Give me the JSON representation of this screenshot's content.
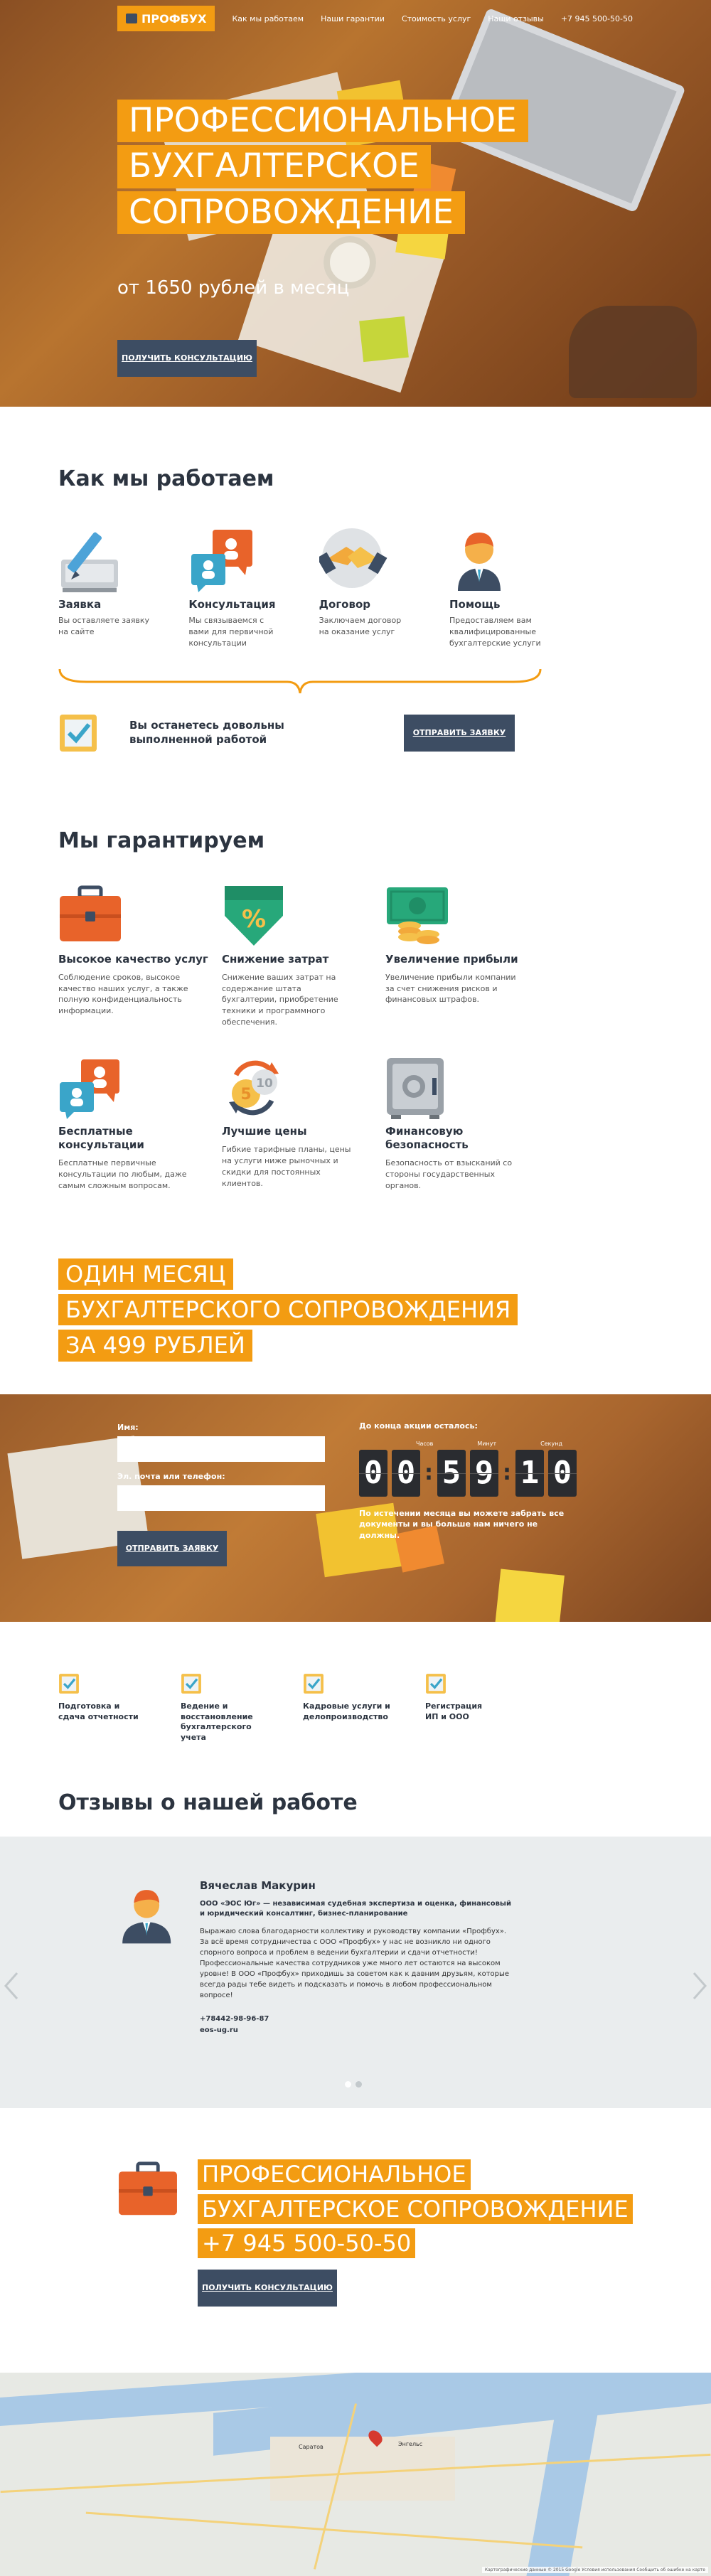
{
  "header": {
    "logo": "ПРОФБУХ",
    "nav": [
      "Как мы работаем",
      "Наши гарантии",
      "Стоимость услуг",
      "Наши отзывы",
      "+7 945 500-50-50"
    ]
  },
  "hero": {
    "title_lines": [
      "ПРОФЕССИОНАЛЬНОЕ",
      "БУХГАЛТЕРСКОЕ",
      "СОПРОВОЖДЕНИЕ"
    ],
    "subtitle": "от 1650 рублей в месяц",
    "button": "получить консультацию"
  },
  "how": {
    "title": "Как мы работаем",
    "steps": [
      {
        "title": "Заявка",
        "text": "Вы оставляете заявку на сайте",
        "icon": "pen-icon"
      },
      {
        "title": "Консультация",
        "text": "Мы связываемся с вами для первичной консультации",
        "icon": "chat-icon"
      },
      {
        "title": "Договор",
        "text": "Заключаем договор на оказание услуг",
        "icon": "handshake-icon"
      },
      {
        "title": "Помощь",
        "text": "Предоставляем вам квалифицированные бухгалтерские услуги",
        "icon": "person-icon"
      }
    ],
    "satisfied": "Вы останетесь довольны выполненной работой",
    "button": "отправить заявку"
  },
  "guarantees": {
    "title": "Мы гарантируем",
    "items": [
      {
        "title": "Высокое качество услуг",
        "text": "Соблюдение сроков, высокое качество наших услуг, а также полную конфиденциальность информации.",
        "icon": "briefcase-icon"
      },
      {
        "title": "Снижение затрат",
        "text": "Снижение ваших затрат на содержание штата бухгалтерии, приобретение техники и программного обеспечения.",
        "icon": "percent-icon"
      },
      {
        "title": "Увеличение прибыли",
        "text": "Увеличение прибыли компании за счет снижения рисков и финансовых штрафов.",
        "icon": "money-icon"
      },
      {
        "title": "Бесплатные консультации",
        "text": "Бесплатные первичные консультации по любым, даже самым сложным вопросам.",
        "icon": "chat-icon"
      },
      {
        "title": "Лучшие цены",
        "text": "Гибкие тарифные планы, цены на услуги ниже рыночных и скидки для постоянных клиентов.",
        "icon": "coins-icon"
      },
      {
        "title": "Финансовую безопасность",
        "text": "Безопасность от взысканий со стороны государственных органов.",
        "icon": "safe-icon"
      }
    ]
  },
  "promo": {
    "lines": [
      "ОДИН МЕСЯЦ",
      "БУХГАЛТЕРСКОГО СОПРОВОЖДЕНИЯ",
      "ЗА 499 РУБЛЕЙ"
    ]
  },
  "order": {
    "name_label": "Имя:",
    "contact_label": "Эл. почта или телефон:",
    "button": "отправить заявку",
    "timer_caption": "До конца акции осталось:",
    "timer_labels": [
      "Часов",
      "Минут",
      "Секунд"
    ],
    "digits": [
      "0",
      "0",
      "5",
      "9",
      "1",
      "0"
    ],
    "note": "По истечении месяца вы можете забрать все документы и вы больше нам ничего не должны."
  },
  "services": [
    "Подготовка и сдача отчетности",
    "Ведение и восстановление бухгалтерского учета",
    "Кадровые услуги и делопроизводство",
    "Регистрация ИП и ООО"
  ],
  "reviews": {
    "title": "Отзывы о нашей работе",
    "name": "Вячеслав Макурин",
    "role": "ООО «ЭОС Юг» — независимая судебная экспертиза и оценка, финансовый и юридический консалтинг, бизнес-планирование",
    "text": "Выражаю слова благодарности коллективу и руководству компании «Профбух». За всё время сотрудничества с ООО «Профбух» у нас не возникло ни одного спорного вопроса и проблем в ведении бухгалтерии и сдачи отчетности! Профессиональные качества сотрудников уже много лет остаются на высоком уровне! В ООО «Профбух» приходишь за советом как к давним друзьям, которые всегда рады тебе видеть и подсказать и помочь в любом профессиональном вопросе!",
    "phone": "+78442-98-96-87",
    "site": "eos-ug.ru"
  },
  "cta": {
    "lines": [
      "ПРОФЕССИОНАЛЬНОЕ",
      "БУХГАЛТЕРСКОЕ СОПРОВОЖДЕНИЕ",
      "+7 945 500-50-50"
    ],
    "button": "получить консультацию"
  },
  "map": {
    "labels": [
      "Саратов",
      "Энгельс"
    ],
    "attribution": "Картографические данные © 2015 Google   Условия использования   Сообщить об ошибке на карте"
  },
  "colors": {
    "accent": "#f39c12",
    "dark": "#3d4d63",
    "green": "#27a87a",
    "orange": "#e8632a"
  }
}
